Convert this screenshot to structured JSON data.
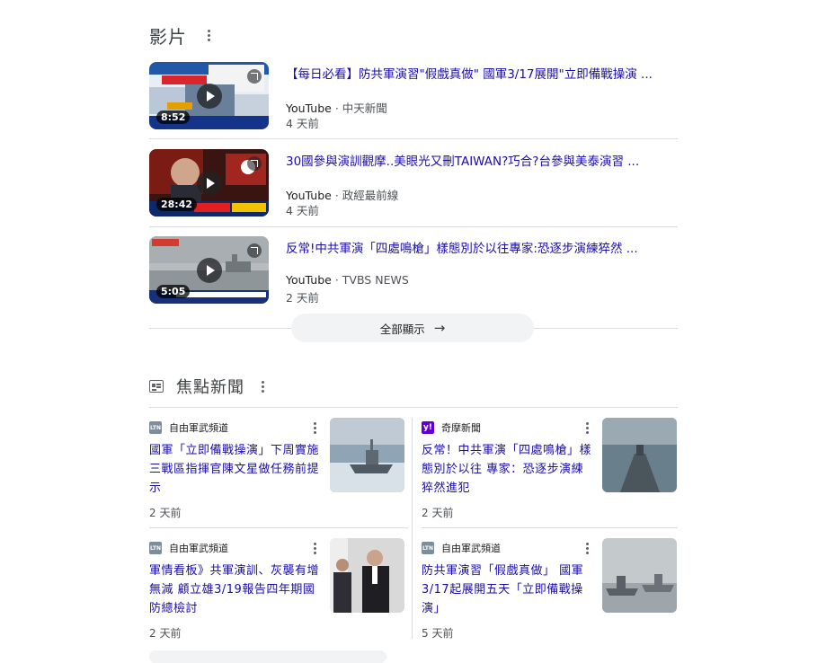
{
  "videos_section": {
    "title": "影片",
    "show_all": "全部顯示",
    "items": [
      {
        "title": "【每日必看】防共軍演習\"假戲真做\" 國軍3/17展開\"立即備戰操演 ...",
        "platform": "YouTube",
        "channel": "中天新聞",
        "age": "4 天前",
        "duration": "8:52"
      },
      {
        "title": "30國參與演訓觀摩..美眼光又刪TAIWAN?巧合?台參與美泰演習 ...",
        "platform": "YouTube",
        "channel": "政經最前線",
        "age": "4 天前",
        "duration": "28:42"
      },
      {
        "title": "反常!中共軍演「四處鳴槍」樣態別於以往專家:恐逐步演練猝然 ...",
        "platform": "YouTube",
        "channel": "TVBS NEWS",
        "age": "2 天前",
        "duration": "5:05"
      }
    ]
  },
  "news_section": {
    "title": "焦點新聞",
    "cards": [
      {
        "publisher": "自由軍武頻道",
        "logo": "LTN",
        "title": "國軍「立即備戰操演」下周實施 三戰區指揮官陳文星做任務前提示",
        "age": "2 天前"
      },
      {
        "publisher": "奇摩新聞",
        "logo": "y!",
        "title": "反常！中共軍演「四處鳴槍」樣態別於以往 專家：恐逐步演練猝然進犯",
        "age": "2 天前"
      },
      {
        "publisher": "自由軍武頻道",
        "logo": "LTN",
        "title": "軍情看板》共軍演訓、灰襲有增無減 顧立雄3/19報告四年期國防總檢討",
        "age": "2 天前"
      },
      {
        "publisher": "自由軍武頻道",
        "logo": "LTN",
        "title": "防共軍演習「假戲真做」 國軍3/17起展開五天「立即備戰操演」",
        "age": "5 天前"
      }
    ]
  }
}
